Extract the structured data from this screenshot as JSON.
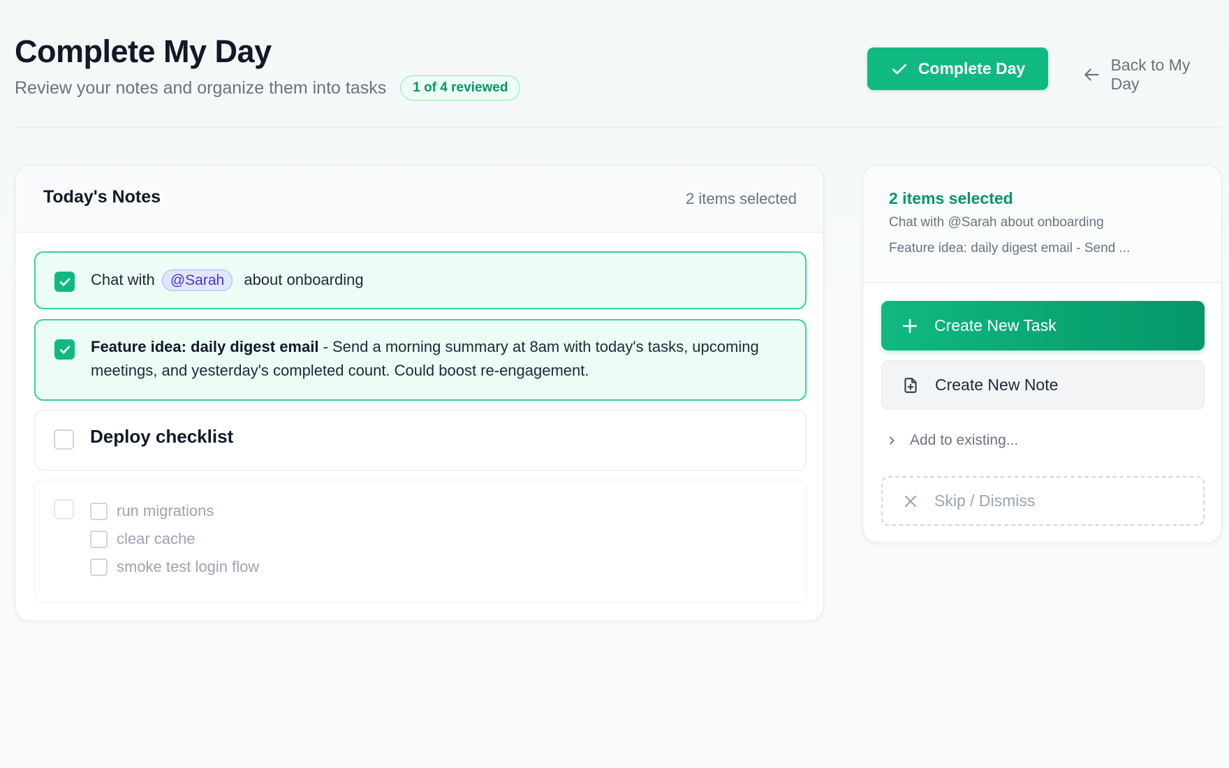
{
  "header": {
    "title": "Complete My Day",
    "subtitle": "Review your notes and organize them into tasks",
    "reviewed_badge": "1 of 4 reviewed",
    "complete_button": "Complete Day",
    "back_link": "Back to My Day"
  },
  "notes_panel": {
    "title": "Today's Notes",
    "selected_count": "2 items selected",
    "notes": [
      {
        "checked": true,
        "prefix": "Chat with",
        "mention": "@Sarah",
        "suffix": "about onboarding"
      },
      {
        "checked": true,
        "bold_title": "Feature idea: daily digest email",
        "body": " - Send a morning summary at 8am with today's tasks, upcoming meetings, and yesterday's completed count. Could boost re-engagement."
      },
      {
        "checked": false,
        "heading": "Deploy checklist"
      },
      {
        "checked": false,
        "subitems": [
          "run migrations",
          "clear cache",
          "smoke test login flow"
        ]
      }
    ]
  },
  "actions_panel": {
    "selected_title": "2 items selected",
    "selected_items": [
      "Chat with @Sarah about onboarding",
      "Feature idea: daily digest email - Send ..."
    ],
    "create_task": "Create New Task",
    "create_note": "Create New Note",
    "add_existing": "Add to existing...",
    "skip": "Skip / Dismiss"
  },
  "colors": {
    "accent": "#10b981",
    "accent_dark": "#059669",
    "mention_bg": "#e0e7ff"
  },
  "icons": {
    "complete": "check-icon",
    "back": "arrow-left-icon",
    "checkbox": "check-icon",
    "create_task": "plus-icon",
    "create_note": "file-plus-icon",
    "add_existing": "chevron-right-icon",
    "skip": "close-icon"
  }
}
